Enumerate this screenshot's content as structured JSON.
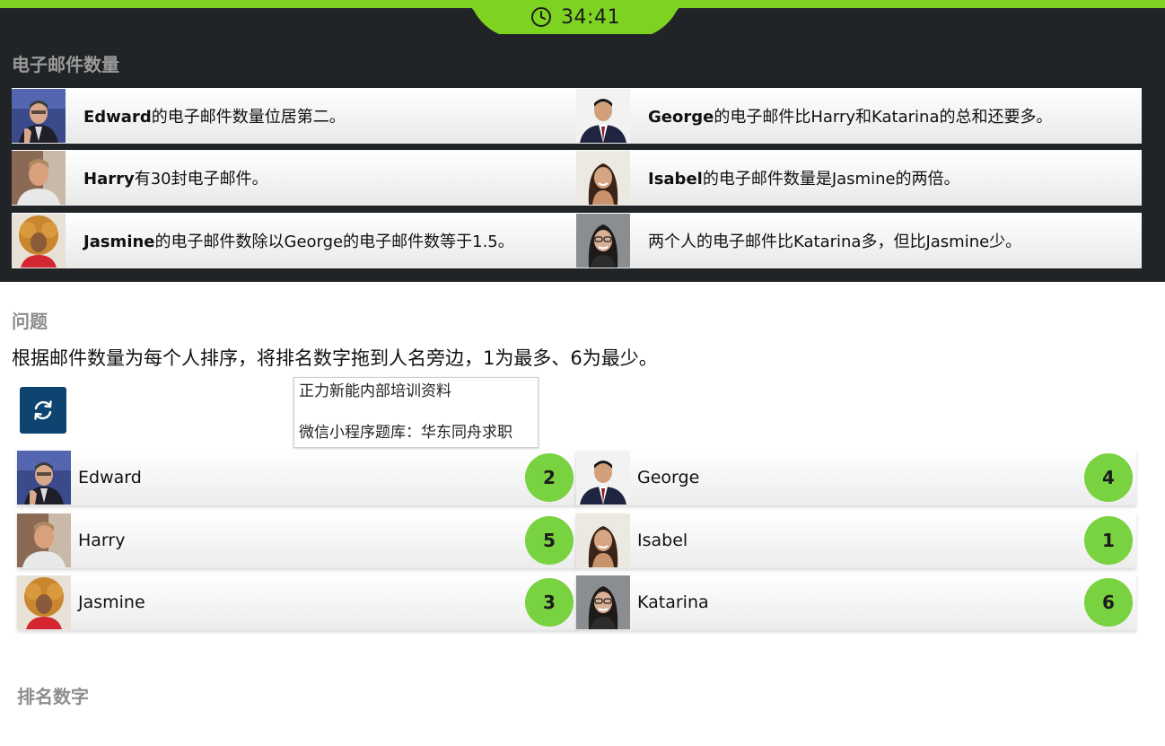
{
  "timer": {
    "value": "34:41",
    "icon": "clock-icon"
  },
  "colors": {
    "accent": "#7ed321",
    "dark_bg": "#212427",
    "badge": "#79d23f",
    "button": "#0f4470"
  },
  "clues_section": {
    "title": "电子邮件数量",
    "clues": [
      {
        "person": "Edward",
        "bold": "Edward",
        "text": "的电子邮件数量位居第二。"
      },
      {
        "person": "George",
        "bold": "George",
        "text": "的电子邮件比Harry和Katarina的总和还要多。"
      },
      {
        "person": "Harry",
        "bold": "Harry",
        "text": "有30封电子邮件。"
      },
      {
        "person": "Isabel",
        "bold": "Isabel",
        "text": "的电子邮件数量是Jasmine的两倍。"
      },
      {
        "person": "Jasmine",
        "bold": "Jasmine",
        "text": "的电子邮件数除以George的电子邮件数等于1.5。"
      },
      {
        "person": "Katarina",
        "bold": "",
        "text": "两个人的电子邮件比Katarina多，但比Jasmine少。"
      }
    ]
  },
  "question": {
    "title": "问题",
    "text": "根据邮件数量为每个人排序，将排名数字拖到人名旁边，1为最多、6为最少。",
    "reset_icon": "refresh-icon"
  },
  "tooltip": {
    "line1": "正力新能内部培训资料",
    "line2": "微信小程序题库：华东同舟求职"
  },
  "ranking": [
    {
      "name": "Edward",
      "rank": "2"
    },
    {
      "name": "George",
      "rank": "4"
    },
    {
      "name": "Harry",
      "rank": "5"
    },
    {
      "name": "Isabel",
      "rank": "1"
    },
    {
      "name": "Jasmine",
      "rank": "3"
    },
    {
      "name": "Katarina",
      "rank": "6"
    }
  ],
  "bottom": {
    "title": "排名数字"
  }
}
